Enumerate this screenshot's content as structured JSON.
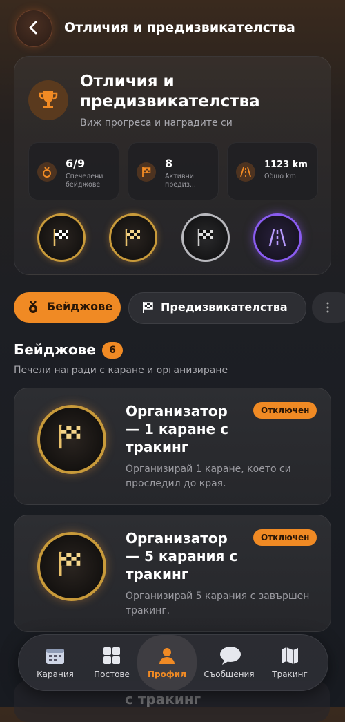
{
  "header": {
    "title": "Отличия и предизвикателства"
  },
  "hero": {
    "title": "Отличия и предизвикателства",
    "subtitle": "Виж прогреса и наградите си",
    "stats": [
      {
        "value": "6/9",
        "label": "Спечелени бейджове",
        "icon": "medal-icon"
      },
      {
        "value": "8",
        "label": "Активни предиз...",
        "icon": "flag-icon"
      },
      {
        "value": "1123 km",
        "label": "Общо km",
        "icon": "road-icon"
      }
    ],
    "medals": [
      "gold-flag",
      "gold-flag",
      "silver-flag",
      "purple-road"
    ]
  },
  "tabs": {
    "badges": "Бейджове",
    "challenges": "Предизвикателства"
  },
  "section": {
    "title": "Бейджове",
    "count": "6",
    "subtitle": "Печели награди с каране и организиране"
  },
  "cards": [
    {
      "title": "Организатор — 1 каране с тракинг",
      "description": "Организирай 1 каране, което си проследил до края.",
      "badge": "Отключен"
    },
    {
      "title": "Организатор — 5 карания с тракинг",
      "description": "Организирай 5 карания с завършен тракинг.",
      "badge": "Отключен"
    }
  ],
  "ghost_card": {
    "title": "с тракинг"
  },
  "nav": {
    "items": [
      {
        "label": "Карания"
      },
      {
        "label": "Постове"
      },
      {
        "label": "Профил"
      },
      {
        "label": "Съобщения"
      },
      {
        "label": "Тракинг"
      }
    ]
  },
  "colors": {
    "accent": "#f08a24",
    "gold": "#c89a3a",
    "purple": "#8a5cf0"
  }
}
